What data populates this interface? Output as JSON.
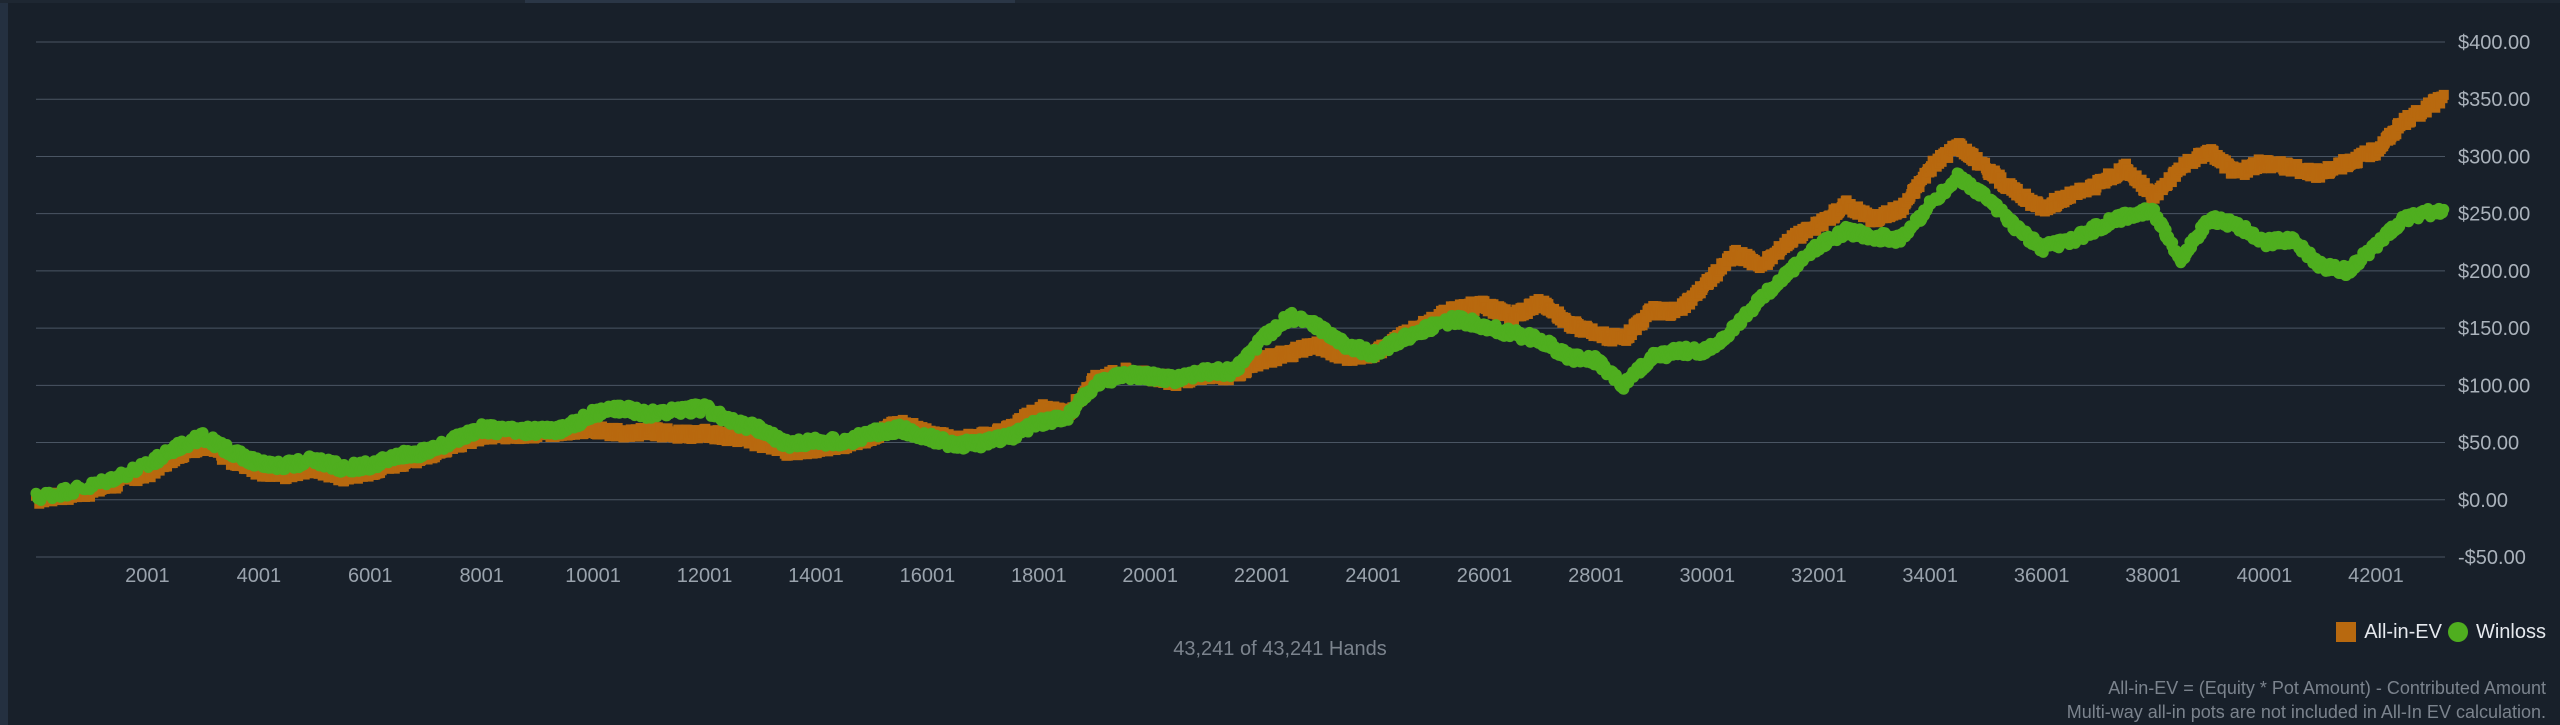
{
  "colors": {
    "background": "#18202a",
    "grid": "#4a5563",
    "allin": "#b8690f",
    "winloss": "#4fae1f"
  },
  "hands_label": "43,241 of 43,241 Hands",
  "legend": {
    "allin_label": "All-in-EV",
    "winloss_label": "Winloss",
    "position": "bottom-right"
  },
  "footnote": {
    "line1": "All-in-EV = (Equity * Pot Amount) - Contributed Amount",
    "line2": "Multi-way all-in pots are not included in All-In EV calculation."
  },
  "chart_data": {
    "type": "scatter",
    "title": "",
    "xlabel": "",
    "ylabel": "",
    "xlim": [
      1,
      43241
    ],
    "ylim": [
      -50,
      400
    ],
    "grid": true,
    "y_axis_side": "right",
    "x_ticks": [
      2001,
      4001,
      6001,
      8001,
      10001,
      12001,
      14001,
      16001,
      18001,
      20001,
      22001,
      24001,
      26001,
      28001,
      30001,
      32001,
      34001,
      36001,
      38001,
      40001,
      42001
    ],
    "y_ticks": [
      -50,
      0,
      50,
      100,
      150,
      200,
      250,
      300,
      350,
      400
    ],
    "y_tick_labels": [
      "-$50.00",
      "$0.00",
      "$50.00",
      "$100.00",
      "$150.00",
      "$200.00",
      "$250.00",
      "$300.00",
      "$350.00",
      "$400.00"
    ],
    "series": [
      {
        "name": "All-in-EV",
        "marker": "square",
        "color": "#b8690f",
        "x": [
          1,
          1000,
          2000,
          2500,
          3000,
          3500,
          4000,
          4500,
          5000,
          5500,
          6000,
          6500,
          7000,
          7500,
          8000,
          8500,
          9000,
          9500,
          10000,
          10500,
          11000,
          11500,
          12000,
          12500,
          13000,
          13500,
          14000,
          14500,
          15000,
          15500,
          16000,
          16500,
          17000,
          17500,
          18000,
          18500,
          19000,
          19500,
          20000,
          20500,
          21000,
          21500,
          22000,
          22500,
          23000,
          23500,
          24000,
          24500,
          25000,
          25500,
          26000,
          26500,
          27000,
          27500,
          28000,
          28500,
          29000,
          29500,
          30000,
          30500,
          31000,
          31500,
          32000,
          32500,
          33000,
          33500,
          34000,
          34500,
          35000,
          35500,
          36000,
          36500,
          37000,
          37500,
          38000,
          38500,
          39000,
          39500,
          40000,
          40500,
          41000,
          41500,
          42000,
          42500,
          43241
        ],
        "y": [
          0,
          7,
          22,
          38,
          48,
          35,
          25,
          22,
          28,
          20,
          25,
          32,
          38,
          48,
          55,
          57,
          58,
          60,
          62,
          58,
          60,
          57,
          58,
          55,
          50,
          42,
          45,
          48,
          55,
          68,
          58,
          52,
          55,
          62,
          80,
          75,
          105,
          112,
          108,
          103,
          110,
          108,
          122,
          128,
          135,
          125,
          128,
          142,
          155,
          168,
          170,
          160,
          172,
          155,
          145,
          140,
          165,
          165,
          190,
          215,
          205,
          228,
          240,
          258,
          245,
          255,
          290,
          310,
          290,
          270,
          255,
          265,
          275,
          290,
          265,
          290,
          305,
          285,
          295,
          290,
          285,
          295,
          305,
          330,
          352
        ]
      },
      {
        "name": "Winloss",
        "marker": "circle",
        "color": "#4fae1f",
        "x": [
          1,
          1000,
          2000,
          2500,
          3000,
          3500,
          4000,
          4500,
          5000,
          5500,
          6000,
          6500,
          7000,
          7500,
          8000,
          8500,
          9000,
          9500,
          10000,
          10500,
          11000,
          11500,
          12000,
          12500,
          13000,
          13500,
          14000,
          14500,
          15000,
          15500,
          16000,
          16500,
          17000,
          17500,
          18000,
          18500,
          19000,
          19500,
          20000,
          20500,
          21000,
          21500,
          22000,
          22500,
          23000,
          23500,
          24000,
          24500,
          25000,
          25500,
          26000,
          26500,
          27000,
          27500,
          28000,
          28500,
          29000,
          29500,
          30000,
          30500,
          31000,
          31500,
          32000,
          32500,
          33000,
          33500,
          34000,
          34500,
          35000,
          35500,
          36000,
          36500,
          37000,
          37500,
          38000,
          38500,
          39000,
          39500,
          40000,
          40500,
          41000,
          41500,
          42000,
          42500,
          43241
        ],
        "y": [
          2,
          12,
          30,
          45,
          55,
          42,
          32,
          30,
          35,
          28,
          30,
          38,
          42,
          52,
          62,
          60,
          60,
          62,
          75,
          80,
          75,
          78,
          80,
          68,
          62,
          48,
          52,
          50,
          58,
          62,
          55,
          48,
          50,
          55,
          68,
          72,
          100,
          110,
          108,
          105,
          112,
          112,
          140,
          160,
          152,
          135,
          128,
          140,
          150,
          158,
          152,
          145,
          140,
          125,
          122,
          100,
          125,
          130,
          130,
          150,
          178,
          200,
          222,
          235,
          230,
          228,
          258,
          282,
          265,
          240,
          220,
          225,
          238,
          248,
          252,
          210,
          245,
          240,
          225,
          228,
          205,
          200,
          222,
          245,
          255
        ]
      }
    ]
  }
}
